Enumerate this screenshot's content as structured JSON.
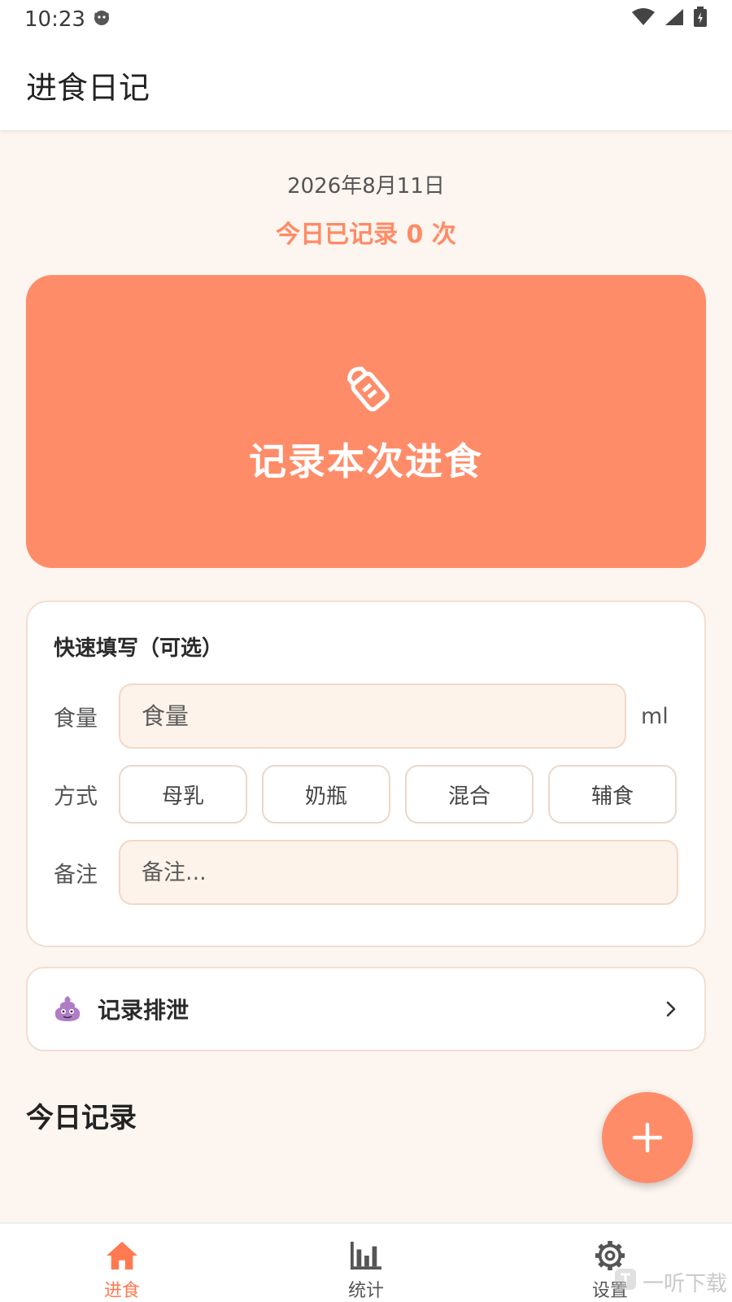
{
  "status_bar": {
    "time": "10:23"
  },
  "app_bar": {
    "title": "进食日记"
  },
  "summary": {
    "date": "2026年8月11日",
    "count_text": "今日已记录 0 次"
  },
  "record_button": {
    "label": "记录本次进食",
    "icon": "baby-bottle-icon"
  },
  "quick_fill": {
    "title": "快速填写（可选）",
    "amount": {
      "label": "食量",
      "placeholder": "食量",
      "value": "",
      "unit": "ml"
    },
    "method": {
      "label": "方式",
      "options": [
        "母乳",
        "奶瓶",
        "混合",
        "辅食"
      ]
    },
    "note": {
      "label": "备注",
      "placeholder": "备注...",
      "value": ""
    }
  },
  "excretion": {
    "label": "记录排泄",
    "icon": "poop-icon"
  },
  "today_records": {
    "title": "今日记录"
  },
  "fab": {
    "icon": "plus-icon"
  },
  "bottom_nav": {
    "items": [
      {
        "label": "进食",
        "icon": "home-icon",
        "active": true
      },
      {
        "label": "统计",
        "icon": "bar-chart-icon",
        "active": false
      },
      {
        "label": "设置",
        "icon": "gear-icon",
        "active": false
      }
    ]
  },
  "watermark": {
    "text": "一听下载"
  },
  "colors": {
    "accent": "#ff8c69",
    "accent_text": "#ff7a50",
    "background": "#fdf5ef"
  }
}
